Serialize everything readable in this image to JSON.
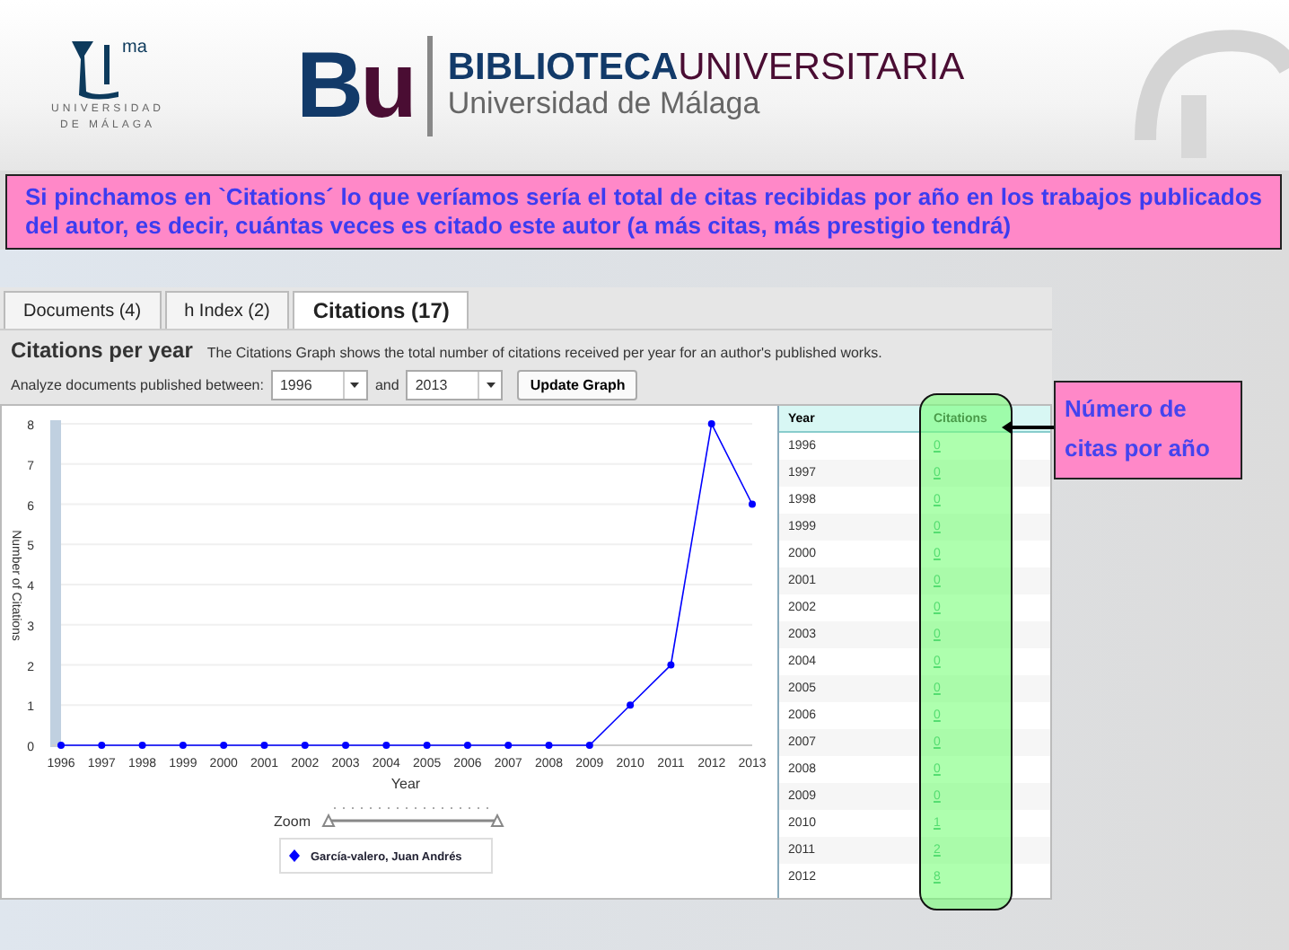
{
  "header": {
    "university_logo": {
      "mark": "ma",
      "lines": [
        "UNIVERSIDAD",
        "DE MÁLAGA"
      ]
    },
    "library_logo": {
      "initials": [
        "B",
        "u"
      ],
      "title_parts": [
        "BIBLIOTECA",
        "UNIVERSITARIA"
      ],
      "subtitle": "Universidad de Málaga"
    }
  },
  "note": "Si pinchamos en `Citations´ lo que veríamos sería el total de citas recibidas por año en los trabajos publicados del autor, es decir, cuántas veces es citado este autor (a más citas, más prestigio tendrá)",
  "callout": "Número de citas por año",
  "tabs": [
    {
      "label": "Documents (4)",
      "selected": false
    },
    {
      "label": "h Index (2)",
      "selected": false
    },
    {
      "label": "Citations (17)",
      "selected": true
    }
  ],
  "section": {
    "title": "Citations per year",
    "description": "The Citations Graph shows the total number of citations received per year for an author's published works."
  },
  "filter": {
    "label": "Analyze documents published between:",
    "from": "1996",
    "joiner": "and",
    "to": "2013",
    "button": "Update Graph"
  },
  "chart": {
    "zoom_label": "Zoom",
    "chart_data": {
      "type": "line",
      "grid": true,
      "xlabel": "Year",
      "ylabel": "Number of Citations",
      "categories": [
        "1996",
        "1997",
        "1998",
        "1999",
        "2000",
        "2001",
        "2002",
        "2003",
        "2004",
        "2005",
        "2006",
        "2007",
        "2008",
        "2009",
        "2010",
        "2011",
        "2012",
        "2013"
      ],
      "series": [
        {
          "name": "García-valero, Juan Andrés",
          "color": "#0000ff",
          "marker": "circle",
          "values": [
            0,
            0,
            0,
            0,
            0,
            0,
            0,
            0,
            0,
            0,
            0,
            0,
            0,
            0,
            1,
            2,
            8,
            6
          ]
        }
      ],
      "ylim": [
        0,
        8
      ],
      "yticks": [
        0,
        1,
        2,
        3,
        4,
        5,
        6,
        7,
        8
      ]
    }
  },
  "table": {
    "columns": [
      "Year",
      "Citations"
    ],
    "rows": [
      {
        "year": "1996",
        "citations": "0"
      },
      {
        "year": "1997",
        "citations": "0"
      },
      {
        "year": "1998",
        "citations": "0"
      },
      {
        "year": "1999",
        "citations": "0"
      },
      {
        "year": "2000",
        "citations": "0"
      },
      {
        "year": "2001",
        "citations": "0"
      },
      {
        "year": "2002",
        "citations": "0"
      },
      {
        "year": "2003",
        "citations": "0"
      },
      {
        "year": "2004",
        "citations": "0"
      },
      {
        "year": "2005",
        "citations": "0"
      },
      {
        "year": "2006",
        "citations": "0"
      },
      {
        "year": "2007",
        "citations": "0"
      },
      {
        "year": "2008",
        "citations": "0"
      },
      {
        "year": "2009",
        "citations": "0"
      },
      {
        "year": "2010",
        "citations": "1"
      },
      {
        "year": "2011",
        "citations": "2"
      },
      {
        "year": "2012",
        "citations": "8"
      }
    ]
  }
}
